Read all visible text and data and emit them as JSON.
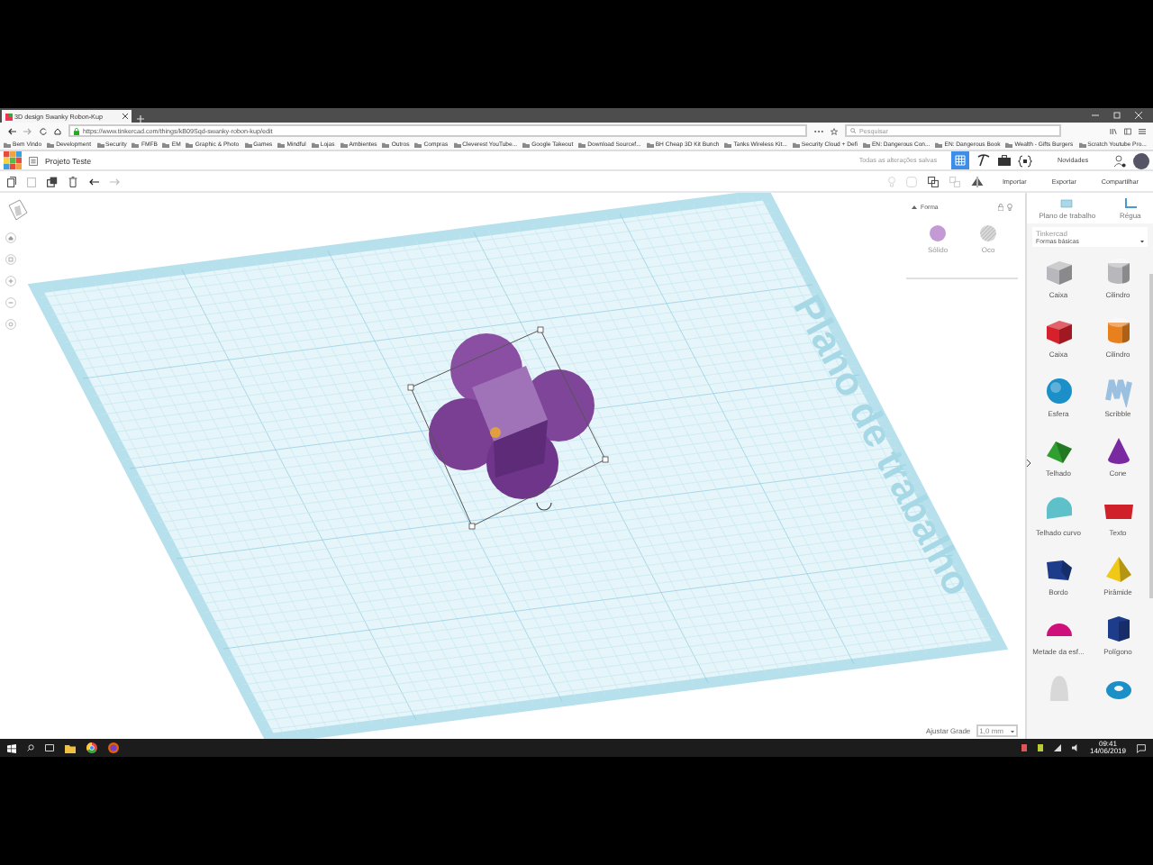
{
  "browser": {
    "tab_title": "3D design Swanky Robon-Kup",
    "url": "https://www.tinkercad.com/things/kB09Sqd-swanky-robon-kup/edit",
    "search_placeholder": "Pesquisar",
    "bookmarks": [
      "Bem Vindo",
      "Development",
      "Security",
      "FMFB",
      "EM",
      "Graphic & Photo",
      "Games",
      "Mindful",
      "Lojas",
      "Ambientes",
      "Outros",
      "Compras",
      "Cleverest YouTube...",
      "Google Takeout",
      "Download Sourcef...",
      "BH Cheap 3D Kit Bunch",
      "Tanks Wireless Kit...",
      "Security Cloud + Defi",
      "EN: Dangerous Con...",
      "EN: Dangerous Book",
      "Wealth - Gifts Burgers",
      "Scratch Youtube Pro..."
    ]
  },
  "app": {
    "project_name": "Projeto Teste",
    "save_status": "Todas as alterações salvas",
    "news": "Novidades",
    "actions": [
      "Importar",
      "Exportar",
      "Compartilhar"
    ]
  },
  "inspector": {
    "title": "Forma",
    "options": [
      {
        "label": "Sólido",
        "kind": "solid"
      },
      {
        "label": "Oco",
        "kind": "hole"
      }
    ]
  },
  "workplane": {
    "label": "Plano de trabalho"
  },
  "grid": {
    "label": "Ajustar Grade",
    "value": "1,0 mm"
  },
  "library": {
    "tabs": [
      "Plano de trabalho",
      "Régua"
    ],
    "category_label": "Tinkercad",
    "category": "Formas básicas",
    "shapes": [
      {
        "label": "Caixa",
        "kind": "box",
        "color": "#b8b8bc"
      },
      {
        "label": "Cilindro",
        "kind": "cylinder",
        "color": "#b8b8bc"
      },
      {
        "label": "Caixa",
        "kind": "box",
        "color": "#d6202c"
      },
      {
        "label": "Cilindro",
        "kind": "cylinder",
        "color": "#e8801e"
      },
      {
        "label": "Esfera",
        "kind": "sphere",
        "color": "#1a8fc8"
      },
      {
        "label": "Scribble",
        "kind": "scribble",
        "color": "#9cc0e0"
      },
      {
        "label": "Telhado",
        "kind": "roof",
        "color": "#2fa02f"
      },
      {
        "label": "Cone",
        "kind": "cone",
        "color": "#7a2aa0"
      },
      {
        "label": "Telhado curvo",
        "kind": "roundroof",
        "color": "#5ec0c8"
      },
      {
        "label": "Texto",
        "kind": "text",
        "color": "#d0202a"
      },
      {
        "label": "Bordo",
        "kind": "wedge",
        "color": "#1e3c8c"
      },
      {
        "label": "Pirâmide",
        "kind": "pyramid",
        "color": "#f0c818"
      },
      {
        "label": "Metade da esf...",
        "kind": "halfsphere",
        "color": "#d0107a"
      },
      {
        "label": "Polígono",
        "kind": "polygon",
        "color": "#1e3c8c"
      },
      {
        "kind": "paraboloid",
        "color": "#d8d8d8"
      },
      {
        "kind": "torus",
        "color": "#1a8fc8"
      }
    ]
  },
  "taskbar": {
    "time": "09:41",
    "date": "14/06/2019"
  }
}
